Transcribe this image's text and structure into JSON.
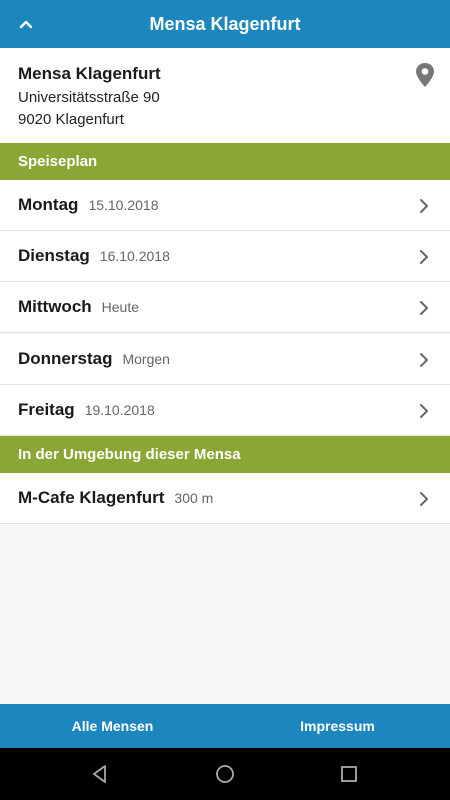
{
  "header": {
    "title": "Mensa Klagenfurt",
    "back_icon": "chevron-up-icon"
  },
  "info": {
    "name": "Mensa Klagenfurt",
    "street": "Universitätsstraße 90",
    "city": "9020 Klagenfurt",
    "location_icon": "map-pin-icon"
  },
  "speiseplan": {
    "title": "Speiseplan",
    "days": [
      {
        "label": "Montag",
        "sub": "15.10.2018"
      },
      {
        "label": "Dienstag",
        "sub": "16.10.2018"
      },
      {
        "label": "Mittwoch",
        "sub": "Heute"
      },
      {
        "label": "Donnerstag",
        "sub": "Morgen"
      },
      {
        "label": "Freitag",
        "sub": "19.10.2018"
      }
    ]
  },
  "nearby": {
    "title": "In der Umgebung dieser Mensa",
    "items": [
      {
        "label": "M-Cafe Klagenfurt",
        "sub": "300 m"
      }
    ]
  },
  "bottom": {
    "all_label": "Alle Mensen",
    "imprint_label": "Impressum"
  },
  "colors": {
    "primary": "#1c87bf",
    "section": "#8aa634"
  }
}
